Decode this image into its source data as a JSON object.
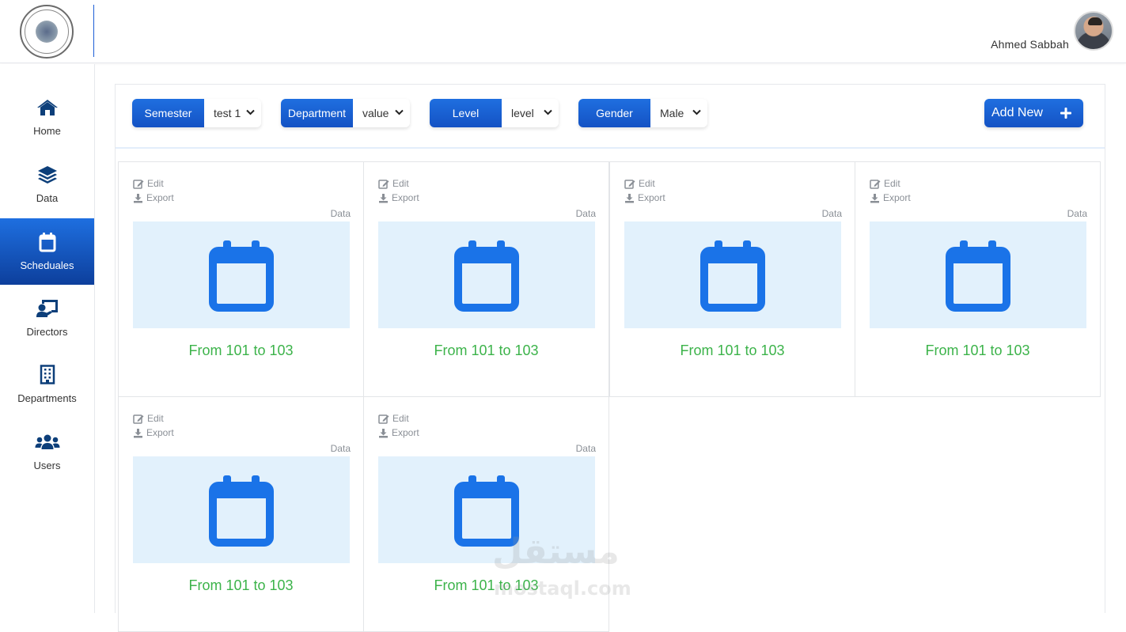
{
  "header": {
    "user_name": "Ahmed Sabbah"
  },
  "sidebar": {
    "items": [
      {
        "label": "Home",
        "icon": "home-icon",
        "active": false
      },
      {
        "label": "Data",
        "icon": "layers-icon",
        "active": false
      },
      {
        "label": "Scheduales",
        "icon": "calendar-icon",
        "active": true
      },
      {
        "label": "Directors",
        "icon": "chalkboard-teacher-icon",
        "active": false
      },
      {
        "label": "Departments",
        "icon": "building-icon",
        "active": false
      },
      {
        "label": "Users",
        "icon": "users-icon",
        "active": false
      }
    ]
  },
  "filters": {
    "semester": {
      "label": "Semester",
      "value": "test 1"
    },
    "department": {
      "label": "Department",
      "value": "value"
    },
    "level": {
      "label": "Level",
      "value": "level"
    },
    "gender": {
      "label": "Gender",
      "value": "Male"
    }
  },
  "add_new": {
    "label": "Add New",
    "icon": "plus-icon"
  },
  "cards": [
    {
      "edit": "Edit",
      "export": "Export",
      "tag": "Data",
      "range": "From 101 to 103"
    },
    {
      "edit": "Edit",
      "export": "Export",
      "tag": "Data",
      "range": "From 101 to 103"
    },
    {
      "edit": "Edit",
      "export": "Export",
      "tag": "Data",
      "range": "From 101 to 103"
    },
    {
      "edit": "Edit",
      "export": "Export",
      "tag": "Data",
      "range": "From 101 to 103"
    },
    {
      "edit": "Edit",
      "export": "Export",
      "tag": "Data",
      "range": "From 101 to 103"
    },
    {
      "edit": "Edit",
      "export": "Export",
      "tag": "Data",
      "range": "From 101 to 103"
    }
  ],
  "watermark": {
    "arabic": "مستقل",
    "latin": "mostaql.com"
  },
  "colors": {
    "primary": "#1f6fe0",
    "primary_dark": "#0d3f9c",
    "thumb_bg": "#e2f1fc",
    "range_text": "#3cb34a",
    "icon_blue": "#1a73e8"
  }
}
